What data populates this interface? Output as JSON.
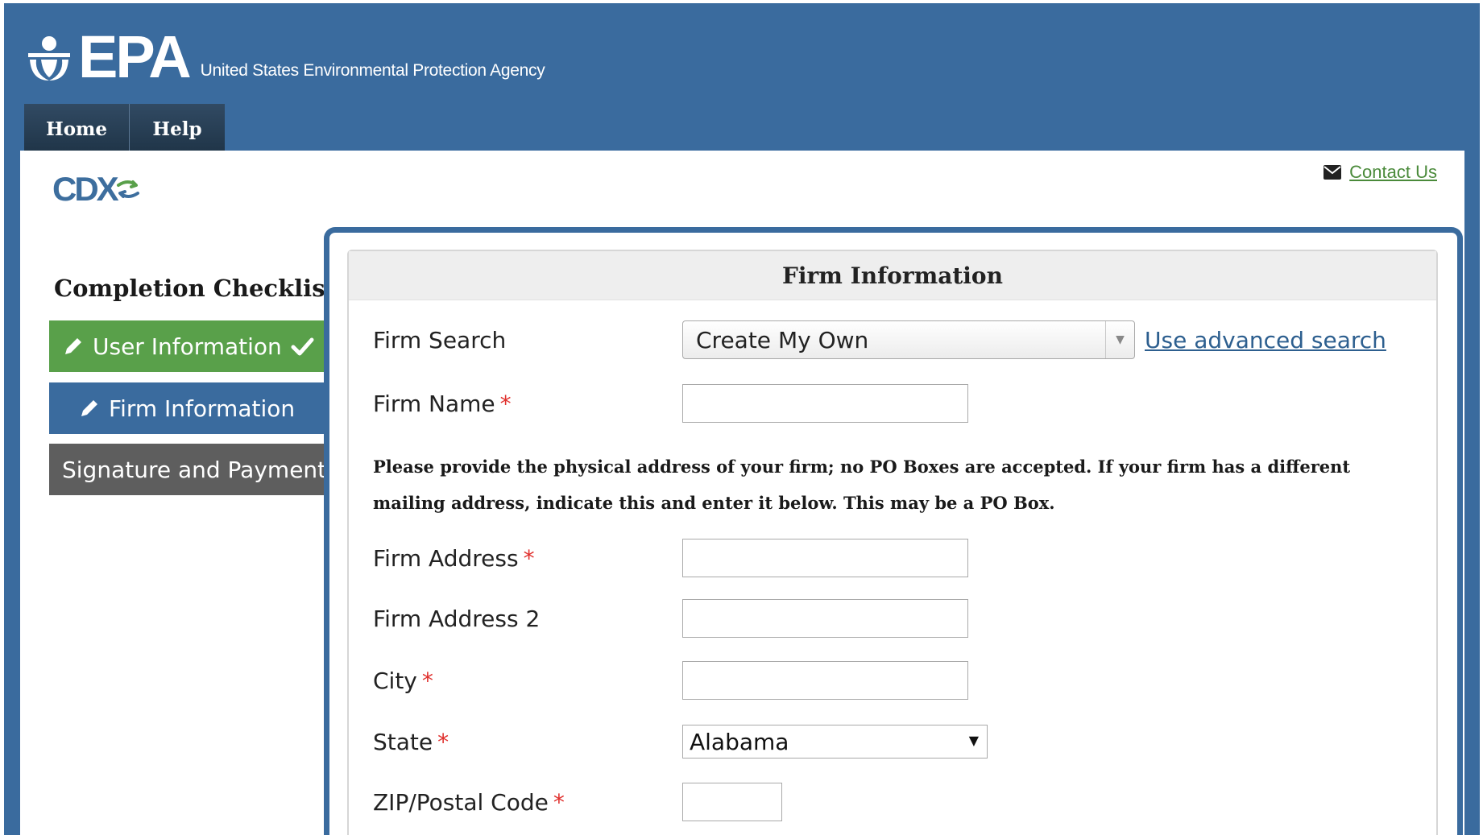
{
  "header": {
    "logo_text": "EPA",
    "agency_name": "United States Environmental Protection Agency"
  },
  "topnav": {
    "home": "Home",
    "help": "Help"
  },
  "brand": {
    "cdx_text": "CDX"
  },
  "contact": {
    "label": "Contact Us"
  },
  "checklist": {
    "title": "Completion Checklist",
    "items": [
      {
        "label": "User Information",
        "status": "complete",
        "color": "#59a04a"
      },
      {
        "label": "Firm Information",
        "status": "current",
        "color": "#3a6b9e"
      },
      {
        "label": "Signature and Payment",
        "status": "pending",
        "color": "#5e5e5e"
      }
    ]
  },
  "panel": {
    "title": "Firm Information",
    "firm_search": {
      "label": "Firm Search",
      "value": "Create My Own",
      "advanced_link": "Use advanced search"
    },
    "firm_name": {
      "label": "Firm Name",
      "required": "*",
      "value": ""
    },
    "note": "Please provide the physical address of your firm; no PO Boxes are accepted. If your firm has a different mailing address, indicate this and enter it below. This may be a PO Box.",
    "firm_address": {
      "label": "Firm Address",
      "required": "*",
      "value": ""
    },
    "firm_address2": {
      "label": "Firm Address 2",
      "value": ""
    },
    "city": {
      "label": "City",
      "required": "*",
      "value": ""
    },
    "state": {
      "label": "State",
      "required": "*",
      "value": "Alabama"
    },
    "zip": {
      "label": "ZIP/Postal Code",
      "required": "*",
      "value": ""
    }
  },
  "colors": {
    "epa_blue": "#3a6b9e",
    "nav_dark": "#1f3447",
    "success_green": "#59a04a",
    "required_red": "#e0302d",
    "link_green": "#4a8a3a"
  }
}
